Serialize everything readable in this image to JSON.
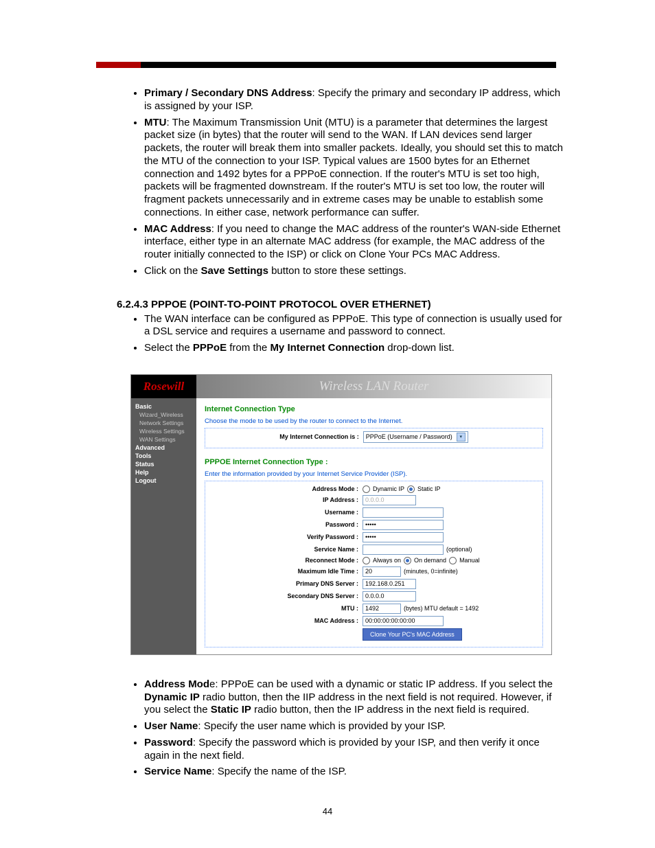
{
  "doc": {
    "bullets_top": [
      {
        "bold": "Primary / Secondary DNS Address",
        "rest": ": Specify the primary and secondary IP address, which is assigned by your ISP."
      },
      {
        "bold": "MTU",
        "rest": ": The Maximum Transmission Unit (MTU) is a parameter that determines the largest packet size (in bytes) that the router will send to the WAN. If LAN devices send larger packets, the router will break them into smaller packets. Ideally, you should set this to match the MTU of the connection to your ISP. Typical values are 1500 bytes for an Ethernet connection and 1492 bytes for a PPPoE connection. If the router's MTU is set too high, packets will be fragmented downstream. If the router's MTU is set too low, the router will fragment packets unnecessarily and in extreme cases may be unable to establish some connections. In either case, network performance can suffer."
      },
      {
        "bold": "MAC Address",
        "rest": ": If you need to change the MAC address of the rounter's WAN-side Ethernet interface, either type in an alternate MAC address (for example, the MAC address of the router initially connected to the ISP) or click on Clone Your PCs MAC Address."
      },
      {
        "prefix": "Click on the ",
        "bold": "Save Settings",
        "rest": " button to store these settings."
      }
    ],
    "section_heading": "6.2.4.3  PPPOE (POINT-TO-POINT PROTOCOL OVER ETHERNET)",
    "bullets_mid": [
      {
        "text": "The WAN interface can be configured as PPPoE. This type of connection is usually used for a DSL service and requires a username and password to connect."
      },
      {
        "prefix": "Select the ",
        "bold1": "PPPoE",
        "mid": " from the ",
        "bold2": "My Internet Connection",
        "suffix": " drop-down list."
      }
    ],
    "bullets_bottom": [
      {
        "bold": "Address Mod",
        "extra": "e",
        "rest": ": PPPoE can be used with a dynamic or static IP address. If you select the ",
        "bold2": "Dynamic IP",
        "rest2": " radio button, then the IIP address in the next field is not required. However, if you select the ",
        "bold3": "Static IP",
        "rest3": " radio button, then the IP address in the next field is required."
      },
      {
        "bold": "User Name",
        "rest": ": Specify the user name which is provided by your ISP."
      },
      {
        "bold": "Password",
        "rest": ": Specify the password which is provided by your ISP, and then verify it once again in the next field."
      },
      {
        "bold": "Service Name",
        "rest": ": Specify the name of the ISP."
      }
    ],
    "page_number": "44"
  },
  "router": {
    "logo": "Rosewill",
    "title": "Wireless LAN Router",
    "nav": {
      "basic": "Basic",
      "sub": [
        "Wizard_Wireless",
        "Network Settings",
        "Wireless Settings",
        "WAN Settings"
      ],
      "groups": [
        "Advanced",
        "Tools",
        "Status",
        "Help",
        "Logout"
      ]
    },
    "section1": {
      "title": "Internet Connection Type",
      "sub": "Choose the mode to be used by the router to connect to the Internet.",
      "select_label": "My Internet Connection is :",
      "select_value": "PPPoE (Username / Password)"
    },
    "section2": {
      "title": "PPPOE Internet Connection Type :",
      "sub": "Enter the information provided by your Internet Service Provider (ISP).",
      "rows": {
        "address_mode_label": "Address Mode :",
        "address_mode_opts": [
          "Dynamic IP",
          "Static IP"
        ],
        "ip_label": "IP Address :",
        "ip_value": "0.0.0.0",
        "username_label": "Username :",
        "username_value": "",
        "password_label": "Password :",
        "password_value": "•••••",
        "verify_label": "Verify Password :",
        "verify_value": "•••••",
        "service_label": "Service Name :",
        "service_value": "",
        "service_note": "(optional)",
        "reconnect_label": "Reconnect Mode :",
        "reconnect_opts": [
          "Always on",
          "On demand",
          "Manual"
        ],
        "idle_label": "Maximum Idle Time :",
        "idle_value": "20",
        "idle_note": "(minutes, 0=infinite)",
        "pdns_label": "Primary DNS Server :",
        "pdns_value": "192.168.0.251",
        "sdns_label": "Secondary DNS Server :",
        "sdns_value": "0.0.0.0",
        "mtu_label": "MTU :",
        "mtu_value": "1492",
        "mtu_note": "(bytes) MTU default = 1492",
        "mac_label": "MAC Address :",
        "mac_value": "00:00:00:00:00:00",
        "clone_btn": "Clone Your PC's MAC Address"
      }
    }
  }
}
